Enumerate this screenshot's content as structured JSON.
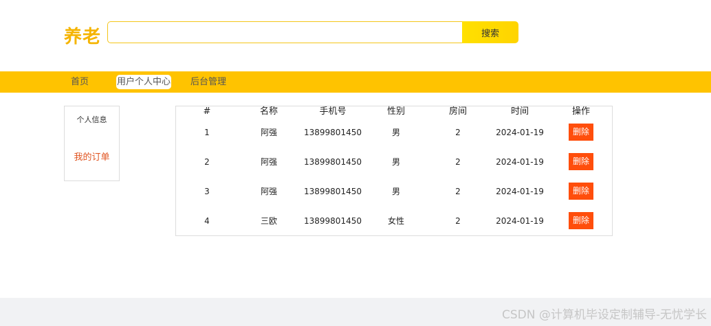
{
  "header": {
    "logo": "养老",
    "search_placeholder": "",
    "search_value": "",
    "search_button": "搜索"
  },
  "nav": {
    "items": [
      {
        "label": "首页"
      },
      {
        "label": "用户个人中心"
      },
      {
        "label": "后台管理"
      }
    ]
  },
  "sidebar": {
    "title": "个人信息",
    "link": "我的订单"
  },
  "table": {
    "headers": [
      "#",
      "名称",
      "手机号",
      "性别",
      "房间",
      "时间",
      "操作"
    ],
    "rows": [
      {
        "id": "1",
        "name": "阿强",
        "phone": "13899801450",
        "gender": "男",
        "room": "2",
        "time": "2024-01-19",
        "action": "删除"
      },
      {
        "id": "2",
        "name": "阿强",
        "phone": "13899801450",
        "gender": "男",
        "room": "2",
        "time": "2024-01-19",
        "action": "删除"
      },
      {
        "id": "3",
        "name": "阿强",
        "phone": "13899801450",
        "gender": "男",
        "room": "2",
        "time": "2024-01-19",
        "action": "删除"
      },
      {
        "id": "4",
        "name": "三欧",
        "phone": "13899801450",
        "gender": "女性",
        "room": "2",
        "time": "2024-01-19",
        "action": "删除"
      }
    ]
  },
  "footer": {
    "watermark": "CSDN @计算机毕设定制辅导-无忧学长"
  },
  "colors": {
    "brand": "#f5b400",
    "nav_bg": "#ffc300",
    "delete": "#ff4e0c",
    "link": "#e0531f"
  }
}
